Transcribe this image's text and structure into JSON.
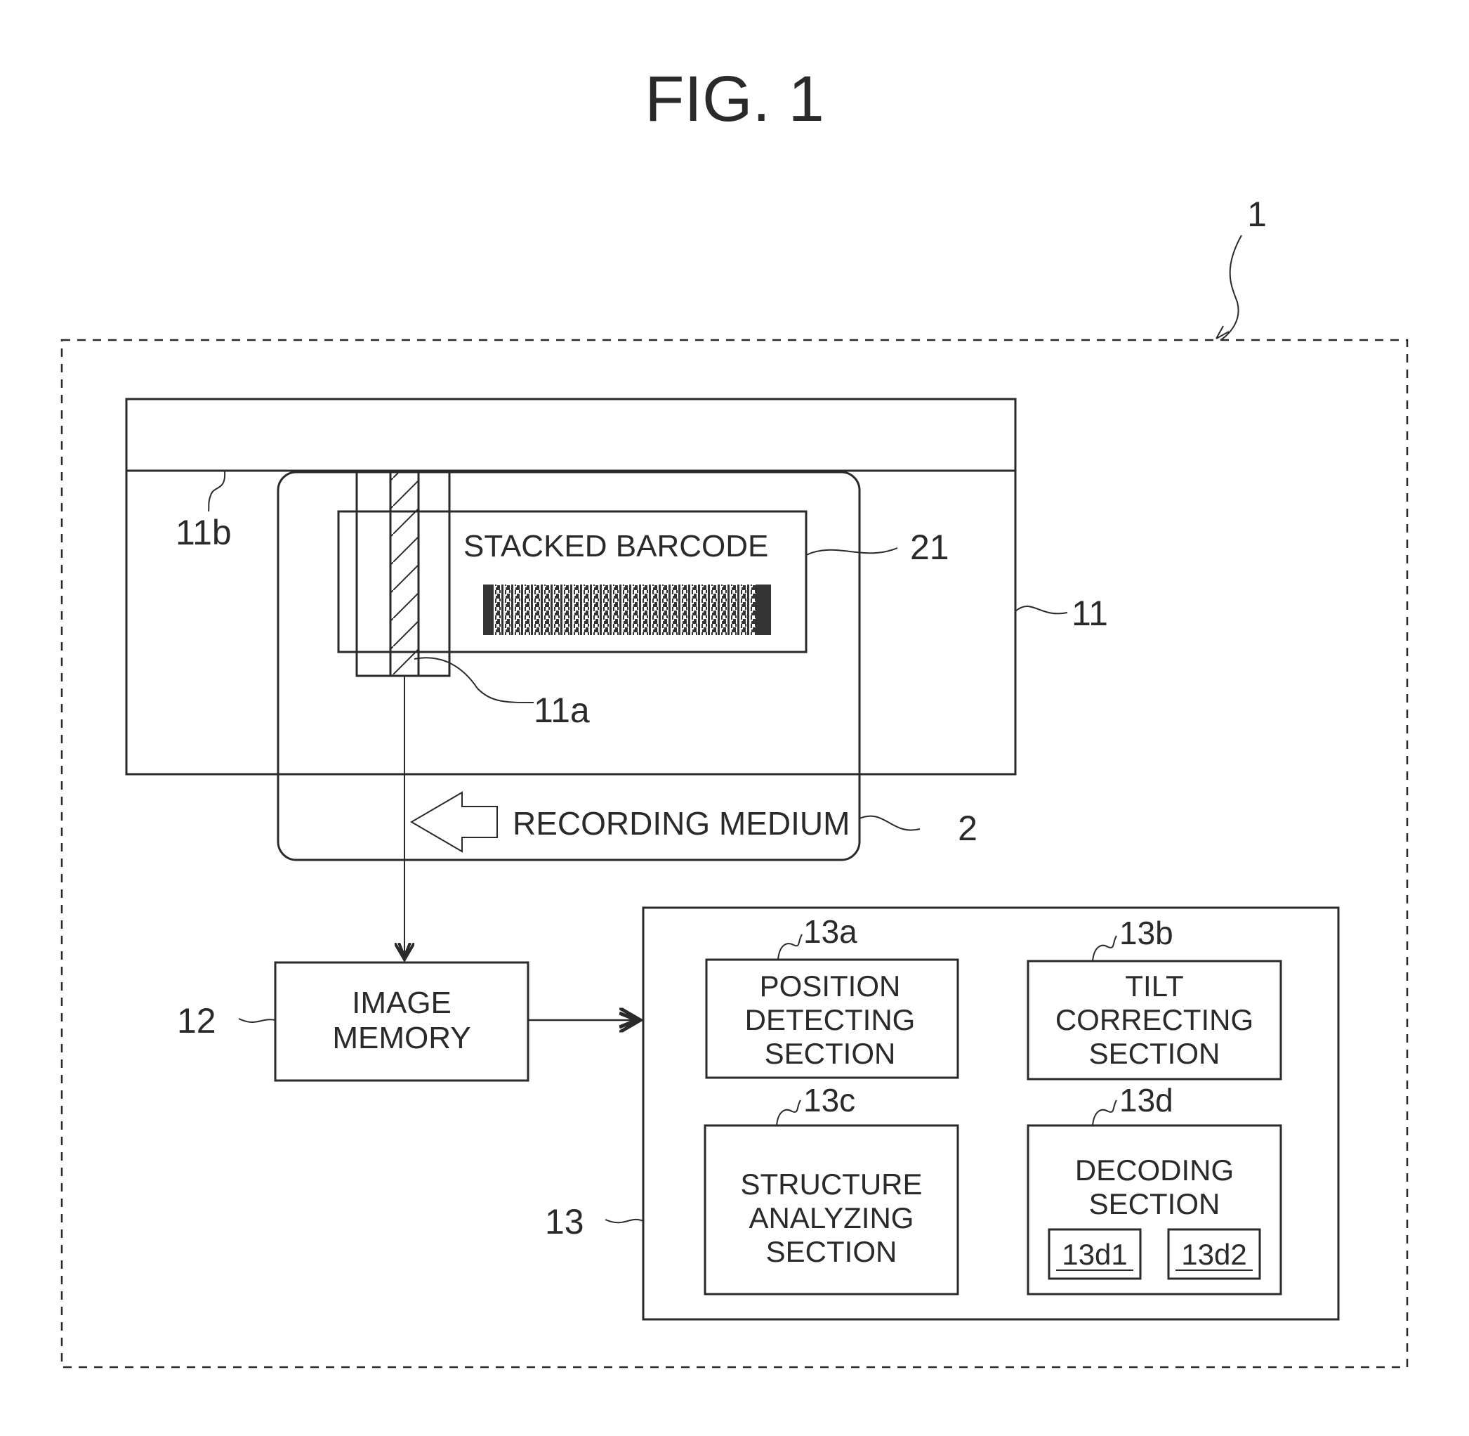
{
  "figure": {
    "title": "FIG. 1",
    "device_ref": "1"
  },
  "scanner": {
    "ref": "11",
    "guide_ref": "11b",
    "sensor_ref": "11a"
  },
  "recording_medium": {
    "ref": "2",
    "label": "RECORDING MEDIUM",
    "direction": "left"
  },
  "barcode": {
    "ref": "21",
    "label": "STACKED BARCODE"
  },
  "image_memory": {
    "ref": "12",
    "lines": [
      "IMAGE",
      "MEMORY"
    ]
  },
  "processor": {
    "ref": "13",
    "sections": [
      {
        "ref": "13a",
        "lines": [
          "POSITION",
          "DETECTING",
          "SECTION"
        ]
      },
      {
        "ref": "13b",
        "lines": [
          "TILT",
          "CORRECTING",
          "SECTION"
        ]
      },
      {
        "ref": "13c",
        "lines": [
          "STRUCTURE",
          "ANALYZING",
          "SECTION"
        ]
      },
      {
        "ref": "13d",
        "lines": [
          "DECODING",
          "SECTION"
        ],
        "subunits": [
          "13d1",
          "13d2"
        ]
      }
    ]
  }
}
